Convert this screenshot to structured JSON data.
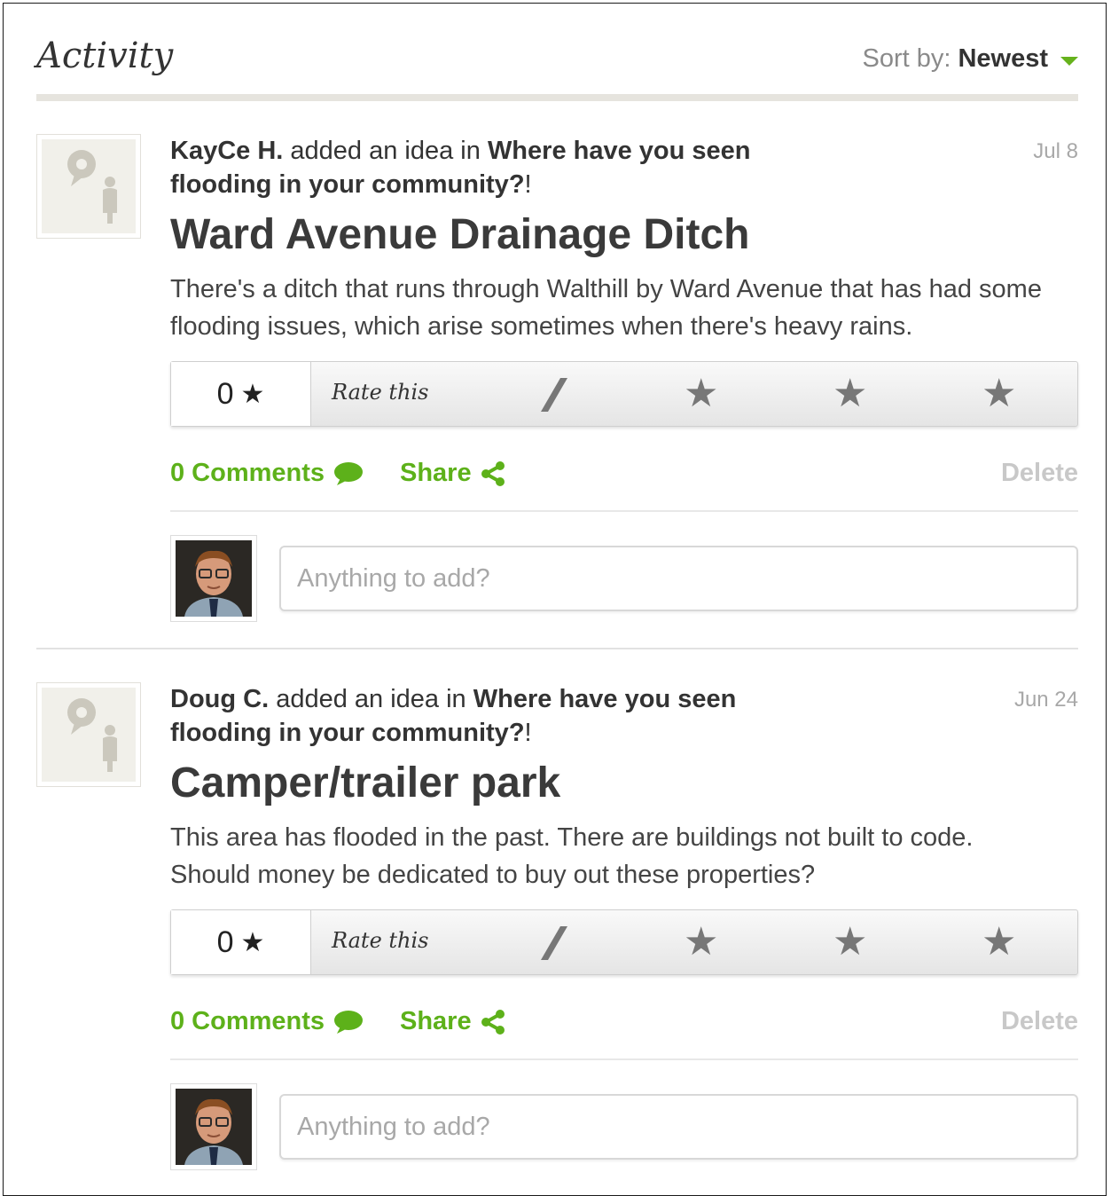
{
  "header": {
    "title": "Activity",
    "sort_label": "Sort by:",
    "sort_value": "Newest"
  },
  "activities": [
    {
      "author": "KayCe H.",
      "action": "added an idea in",
      "topic": "Where have you seen flooding in your community?",
      "topic_suffix": "!",
      "date": "Jul 8",
      "title": "Ward Avenue Drainage Ditch",
      "description": "There's a ditch that runs through Walthill by Ward Avenue that has had some flooding issues, which arise sometimes when there's heavy rains.",
      "rating_score": "0",
      "rate_label": "Rate this",
      "comments_label": "0 Comments",
      "share_label": "Share",
      "delete_label": "Delete",
      "comment_placeholder": "Anything to add?"
    },
    {
      "author": "Doug C.",
      "action": "added an idea in",
      "topic": "Where have you seen flooding in your community?",
      "topic_suffix": "!",
      "date": "Jun 24",
      "title": "Camper/trailer park",
      "description": "This area has flooded in the past. There are buildings not built to code. Should money be dedicated to buy out these properties?",
      "rating_score": "0",
      "rate_label": "Rate this",
      "comments_label": "0 Comments",
      "share_label": "Share",
      "delete_label": "Delete",
      "comment_placeholder": "Anything to add?"
    }
  ],
  "icons": {
    "score_star": "★",
    "rate_star": "★",
    "idea_avatar": "idea-person-icon",
    "comment": "speech-bubble-icon",
    "share": "share-icon",
    "sort_caret": "caret-down-icon"
  },
  "colors": {
    "accent_green": "#5db11a",
    "delete_gray": "#c8c8c8",
    "text_dark": "#333333"
  }
}
